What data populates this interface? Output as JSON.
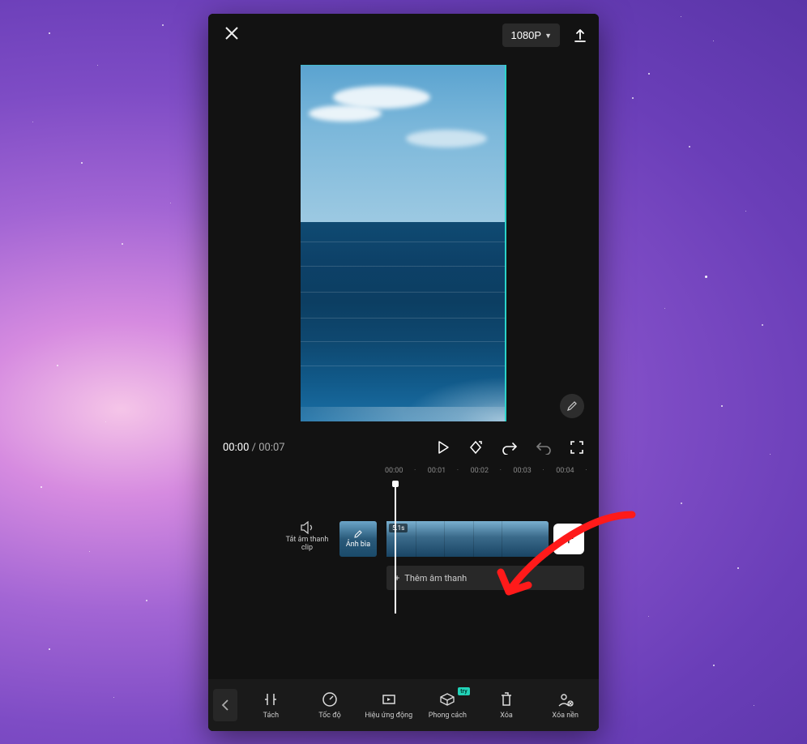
{
  "header": {
    "resolution_label": "1080P"
  },
  "playback": {
    "current_time": "00:00",
    "total_time": "00:07"
  },
  "ruler": [
    "00:00",
    "00:01",
    "00:02",
    "00:03",
    "00:04"
  ],
  "timeline": {
    "mute_label": "Tắt âm thanh clip",
    "cover_label": "Ảnh bìa",
    "clip_duration": "5.1s",
    "add_audio_label": "Thêm âm thanh"
  },
  "tools": {
    "t1": "Tách",
    "t2": "Tốc độ",
    "t3": "Hiệu ứng động",
    "t4": "Phong cách",
    "t4_badge": "try",
    "t5": "Xóa",
    "t6": "Xóa nền"
  }
}
